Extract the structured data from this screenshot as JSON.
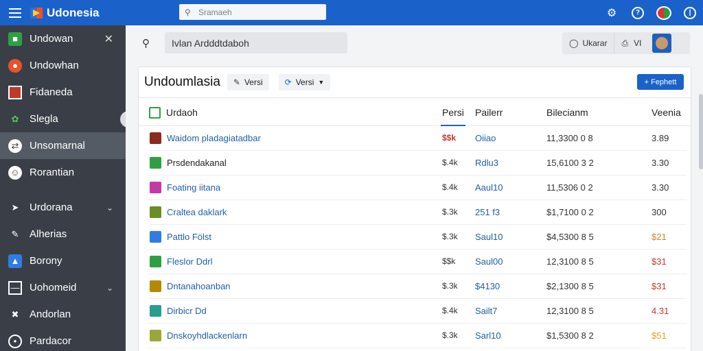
{
  "app": {
    "title": "Udonesia"
  },
  "search": {
    "placeholder": "Sramaeh"
  },
  "sidebar": {
    "items": [
      {
        "label": "Undowan"
      },
      {
        "label": "Undowhan"
      },
      {
        "label": "Fidaneda"
      },
      {
        "label": "Slegla"
      },
      {
        "label": "Unsomarnal"
      },
      {
        "label": "Rorantian"
      },
      {
        "label": "Urdorana"
      },
      {
        "label": "Alherias"
      },
      {
        "label": "Borony"
      },
      {
        "label": "Uohomeid"
      },
      {
        "label": "Andorlan"
      },
      {
        "label": "Pardacor"
      }
    ]
  },
  "main": {
    "search_value": "Ivlan Ardddtdaboh",
    "user": {
      "label": "Ukarar",
      "short": "VI"
    },
    "card": {
      "title": "Undoumlasia",
      "chip1": "Versi",
      "chip2": "Versi",
      "add_label": "+ Fephett",
      "columns": [
        "Urdaoh",
        "Persi",
        "Pailerr",
        "Bilecianm",
        "Veenia"
      ],
      "rows": [
        {
          "name": "Waidom pladagiatadbar",
          "price": "$$k",
          "part": "Oiiao",
          "balance": "11,3300 0 8",
          "version": "3.89"
        },
        {
          "name": "Prsdendakanal",
          "price": "$.4k",
          "part": "Rdlu3",
          "balance": "15,6100 3 2",
          "version": "3.30"
        },
        {
          "name": "Foating iitana",
          "price": "$.4k",
          "part": "Aaul10",
          "balance": "11,5306 0 2",
          "version": "3.30"
        },
        {
          "name": "Craltea daklark",
          "price": "$.3k",
          "part": "251 f3",
          "balance": "$1,7100 0 2",
          "version": "300"
        },
        {
          "name": "Pattlo Fölst",
          "price": "$.3k",
          "part": "Saul10",
          "balance": "$4,5300 8 5",
          "version": "$21"
        },
        {
          "name": "Fleslor Ddrl",
          "price": "$$k",
          "part": "Saul00",
          "balance": "12,3100 8 5",
          "version": "$31"
        },
        {
          "name": "Dntanahoanban",
          "price": "$.3k",
          "part": "$4130",
          "balance": "$2,1300 8 5",
          "version": "$31"
        },
        {
          "name": "Dirbicr Dd",
          "price": "$.4k",
          "part": "Sailt7",
          "balance": "12,3100 8 5",
          "version": "4.31"
        },
        {
          "name": "Dnskoyhdlackenlarn",
          "price": "$.3k",
          "part": "Sarl10",
          "balance": "$1,5300 8 2",
          "version": "$51"
        }
      ]
    }
  },
  "colors": {
    "brand": "#1a62c9",
    "sidebar": "#3a3f47",
    "link": "#1f5fa8"
  }
}
